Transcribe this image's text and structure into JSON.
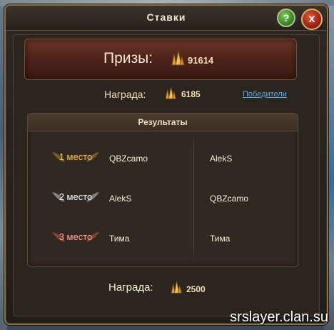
{
  "window": {
    "title": "Ставки"
  },
  "buttons": {
    "help": "?",
    "close": "x"
  },
  "prizes": {
    "label": "Призы:",
    "value": "91614"
  },
  "reward": {
    "label": "Награда:",
    "value": "6185",
    "winners_link": "Победители"
  },
  "results": {
    "title": "Результаты",
    "rows": [
      {
        "place": "1 место",
        "left": "QBZcamo",
        "right": "AlekS"
      },
      {
        "place": "2 место",
        "left": "AlekS",
        "right": "QBZcamo"
      },
      {
        "place": "3 место",
        "left": "Тима",
        "right": "Тима"
      }
    ]
  },
  "bottom_reward": {
    "label": "Награда:",
    "value": "2500"
  },
  "watermark": "srslayer.clan.su",
  "icons": {
    "currency": "gold-crystal-icon"
  },
  "colors": {
    "gold": "#e8c060",
    "silver": "#f3f3f3",
    "bronze": "#f0b0a0",
    "link": "#5aa6e0"
  }
}
